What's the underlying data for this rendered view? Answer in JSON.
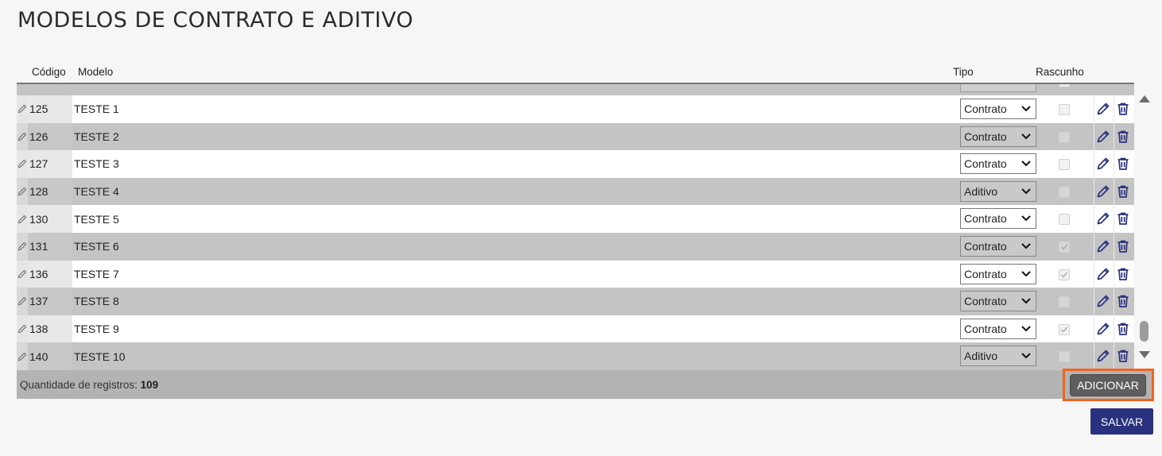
{
  "page": {
    "title": "MODELOS DE CONTRATO E ADITIVO"
  },
  "columns": {
    "code": "Código",
    "model": "Modelo",
    "type": "Tipo",
    "draft": "Rascunho"
  },
  "rows": [
    {
      "code": "125",
      "model": "TESTE 1",
      "type": "Contrato",
      "draft": false
    },
    {
      "code": "126",
      "model": "TESTE 2",
      "type": "Contrato",
      "draft": false
    },
    {
      "code": "127",
      "model": "TESTE 3",
      "type": "Contrato",
      "draft": false
    },
    {
      "code": "128",
      "model": "TESTE 4",
      "type": "Aditivo",
      "draft": false
    },
    {
      "code": "130",
      "model": "TESTE 5",
      "type": "Contrato",
      "draft": false
    },
    {
      "code": "131",
      "model": "TESTE 6",
      "type": "Contrato",
      "draft": true
    },
    {
      "code": "136",
      "model": "TESTE 7",
      "type": "Contrato",
      "draft": true
    },
    {
      "code": "137",
      "model": "TESTE 8",
      "type": "Contrato",
      "draft": false
    },
    {
      "code": "138",
      "model": "TESTE 9",
      "type": "Contrato",
      "draft": true
    },
    {
      "code": "140",
      "model": "TESTE 10",
      "type": "Aditivo",
      "draft": false
    }
  ],
  "footer": {
    "count_label": "Quantidade de registros:",
    "count_value": "109",
    "add_label": "ADICIONAR"
  },
  "actions": {
    "save_label": "SALVAR"
  },
  "icons": {
    "row_edit": "pencil-icon",
    "edit": "edit-pen-icon",
    "delete": "trash-icon",
    "select": "chevron-down-icon",
    "scroll_up": "scroll-up-icon",
    "scroll_down": "scroll-down-icon"
  },
  "colors": {
    "accent": "#2a3280",
    "highlight": "#f0641e",
    "action_icon": "#2a3280"
  }
}
